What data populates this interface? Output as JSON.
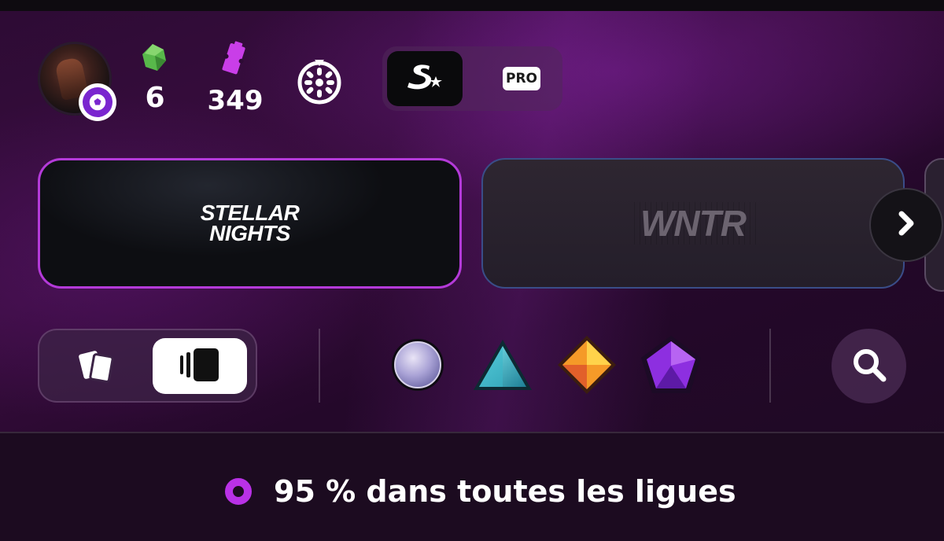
{
  "header": {
    "gems": "6",
    "tickets": "349",
    "mode_toggle": {
      "selected": "s-mode",
      "pro_label": "PRO"
    },
    "icons": [
      "avatar",
      "soccer-ball-icon",
      "gem-icon",
      "ticket-icon",
      "wheel-icon",
      "s-logo-icon"
    ]
  },
  "leagues": {
    "cards": [
      {
        "name": "STELLAR NIGHTS",
        "line1": "STELLAR",
        "line2": "NIGHTS",
        "selected": true
      },
      {
        "name": "WNTR",
        "selected": false
      }
    ]
  },
  "filters": {
    "view_selected": "stack-view",
    "rarities": [
      "rarity-circle",
      "rarity-triangle",
      "rarity-diamond",
      "rarity-pentagon"
    ]
  },
  "status": {
    "completion_text": "95 % dans toutes les ligues",
    "completion_fraction": 0.95
  },
  "colors": {
    "accent": "#b931e6",
    "card_selected_border": "#b43ad9",
    "card_border": "#3a4d88",
    "background": "#2d0b34"
  }
}
